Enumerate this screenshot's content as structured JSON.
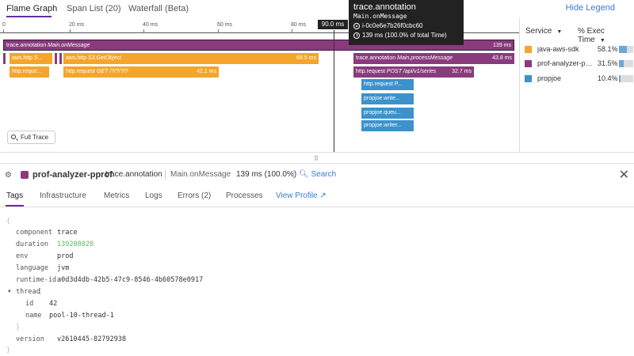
{
  "top_tabs": [
    {
      "label": "Flame Graph"
    },
    {
      "label": "Span List (20)"
    },
    {
      "label": "Waterfall (Beta)"
    }
  ],
  "hide_legend": "Hide Legend",
  "ruler": {
    "ticks": [
      "0",
      "20 ms",
      "40 ms",
      "60 ms",
      "80 ms"
    ],
    "cursor_label": "90.0 ms"
  },
  "tooltip": {
    "title": "trace.annotation",
    "resource": "Main.onMessage",
    "id": "i-0c0e6e7b26f0cbc60",
    "time": "139 ms (100.0% of total Time)"
  },
  "bars": {
    "root": {
      "name": "trace.annotation",
      "resource": "Main.onMessage",
      "dur": "139 ms"
    },
    "aws1": {
      "name": "aws.http S..."
    },
    "aws2": {
      "name": "aws.http",
      "resource": "S3.GetObject",
      "dur": "69.5 ms"
    },
    "proc": {
      "name": "trace.annotation",
      "resource": "Main.processMessage",
      "dur": "43.8 ms"
    },
    "req1": {
      "name": "http.reque..."
    },
    "req2": {
      "name": "http.request",
      "resource": "GET /?/?/?/?",
      "dur": "42.1 ms"
    },
    "req3": {
      "name": "http.request",
      "resource": "POST /api/v1/series",
      "dur": "32.7 ms"
    },
    "pj1": {
      "name": "http.request P..."
    },
    "pj2": {
      "name": "propjoe.write..."
    },
    "pj3": {
      "name": "propjoe.queu..."
    },
    "pj4": {
      "name": "propjoe.writer..."
    }
  },
  "full_trace": "Full Trace",
  "legend": {
    "col_service": "Service",
    "col_exec": "% Exec Time",
    "rows": [
      {
        "name": "java-aws-sdk",
        "pct": "58.1%",
        "color": "#f4a52b",
        "fill": 0.58
      },
      {
        "name": "prof-analyzer-pprof",
        "pct": "31.5%",
        "color": "#8a3b7c",
        "fill": 0.31
      },
      {
        "name": "propjoe",
        "pct": "10.4%",
        "color": "#3b92cc",
        "fill": 0.1
      }
    ]
  },
  "detail": {
    "service": "prof-analyzer-pprof",
    "operation": "trace.annotation",
    "resource": "Main.onMessage",
    "duration": "139 ms (100.0%)",
    "search": "Search"
  },
  "detail_tabs": [
    {
      "label": "Tags"
    },
    {
      "label": "Infrastructure"
    },
    {
      "label": "Metrics"
    },
    {
      "label": "Logs"
    },
    {
      "label": "Errors (2)"
    },
    {
      "label": "Processes"
    },
    {
      "label": "View Profile"
    }
  ],
  "tags": {
    "open": "{",
    "close": "}",
    "component": {
      "k": "component",
      "v": "trace"
    },
    "duration": {
      "k": "duration",
      "v": "139208020"
    },
    "env": {
      "k": "env",
      "v": "prod"
    },
    "language": {
      "k": "language",
      "v": "jvm"
    },
    "runtime_id": {
      "k": "runtime-id",
      "v": "a0d3d4db-42b5-47c9-8546-4b60578e0917"
    },
    "thread": {
      "k": "thread",
      "open": "{",
      "close": "}"
    },
    "thread_id": {
      "k": "id",
      "v": "42"
    },
    "thread_name": {
      "k": "name",
      "v": "pool-10-thread-1"
    },
    "version": {
      "k": "version",
      "v": "v2610445-82792938"
    }
  }
}
